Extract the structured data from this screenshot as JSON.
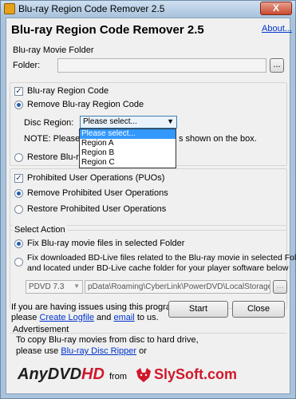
{
  "window": {
    "title": "Blu-ray Region Code Remover 2.5",
    "close_glyph": "X"
  },
  "header": {
    "heading": "Blu-ray Region Code Remover 2.5",
    "about_link": "About..."
  },
  "movie_folder": {
    "group_label": "Blu-ray Movie Folder",
    "folder_label": "Folder:",
    "folder_value": "",
    "browse_label": "..."
  },
  "region_code": {
    "checkbox_label": "Blu-ray Region Code",
    "checked": true,
    "remove_label": "Remove Blu-ray Region Code",
    "disc_region_label": "Disc Region:",
    "selected": "Please select...",
    "options": [
      "Please select...",
      "Region A",
      "Region B",
      "Region C"
    ],
    "note_visible_start": "NOTE: Please s",
    "note_visible_end": "s shown on the box.",
    "restore_visible": "Restore Blu-ra"
  },
  "puo": {
    "checkbox_label": "Prohibited User Operations (PUOs)",
    "checked": true,
    "remove_label": "Remove Prohibited User Operations",
    "restore_label": "Restore Prohibited User Operations"
  },
  "select_action": {
    "group_label": "Select Action",
    "fix_folder_label": "Fix Blu-ray movie files in selected Folder",
    "fix_bdlive_line1": "Fix downloaded BD-Live files related to the Blu-ray movie in selected Folder",
    "fix_bdlive_line2": "and located under BD-Live cache folder for your player software below",
    "player_selected": "PDVD 7.3",
    "cache_path": "pData\\Roaming\\CyberLink\\PowerDVD\\LocalStorage\\",
    "browse_label": "..."
  },
  "footer": {
    "help_line1": "If you are having issues using this program,",
    "help_prefix": "please",
    "create_logfile": "Create Logfile",
    "and": "and",
    "email": "email",
    "to_us": "to us.",
    "start_label": "Start",
    "close_label": "Close"
  },
  "advertisement": {
    "group_label": "Advertisement",
    "line1": "To copy Blu-ray movies from disc to hard drive,",
    "line2_prefix": "please use",
    "ripper_link": "Blu-ray Disc Ripper",
    "line2_suffix": "or",
    "anydvd_text": "AnyDVD",
    "anydvd_hd": "HD",
    "from_text": "from",
    "slysoft_text": "SlySoft.com"
  },
  "colors": {
    "accent_blue": "#1c5fb8",
    "link": "#0033cc",
    "slysoft_red": "#d0182b"
  }
}
